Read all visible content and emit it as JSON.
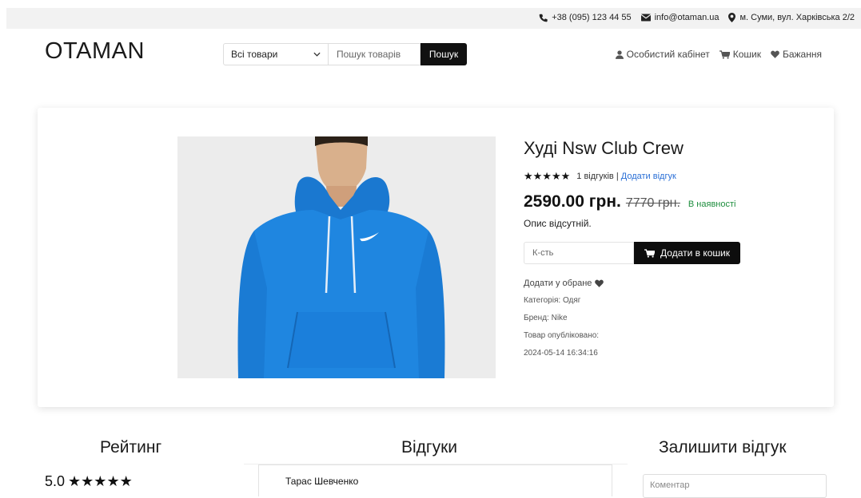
{
  "topbar": {
    "phone": "+38 (095) 123 44 55",
    "email": "info@otaman.ua",
    "address": "м. Суми, вул. Харківська 2/2"
  },
  "header": {
    "logo": "OTAMAN",
    "category_select": "Всі товари",
    "search_placeholder": "Пошук товарів",
    "search_button": "Пошук",
    "nav": {
      "account": "Особистий кабінет",
      "cart": "Кошик",
      "wishlist": "Бажання"
    }
  },
  "product": {
    "title": "Худі Nsw Club Crew",
    "stars": "★★★★★",
    "reviews_count": "1 відгуків",
    "separator": "|",
    "add_review": "Додати відгук",
    "price": "2590.00 грн.",
    "old_price": "7770 грн.",
    "stock": "В наявності",
    "description": "Опис відсутній.",
    "qty_placeholder": "К-сть",
    "add_to_cart": "Додати в кошик",
    "add_to_favorites": "Додати у обране",
    "category": "Категорія: Одяг",
    "brand": "Бренд: Nike",
    "published_label": "Товар опубліковано:",
    "published_date": "2024-05-14 16:34:16"
  },
  "reviews_section": {
    "rating_heading": "Рейтинг",
    "rating_score": "5.0",
    "rating_stars": "★★★★★",
    "reviews_heading": "Відгуки",
    "review_author": "Тарас Шевченко",
    "leave_heading": "Залишити відгук",
    "comment_placeholder": "Коментар"
  },
  "colors": {
    "accent_black": "#0d0d0d",
    "link_blue": "#2a6fd6",
    "stock_green": "#1e8e3e",
    "hoodie_blue": "#1f86e0"
  }
}
